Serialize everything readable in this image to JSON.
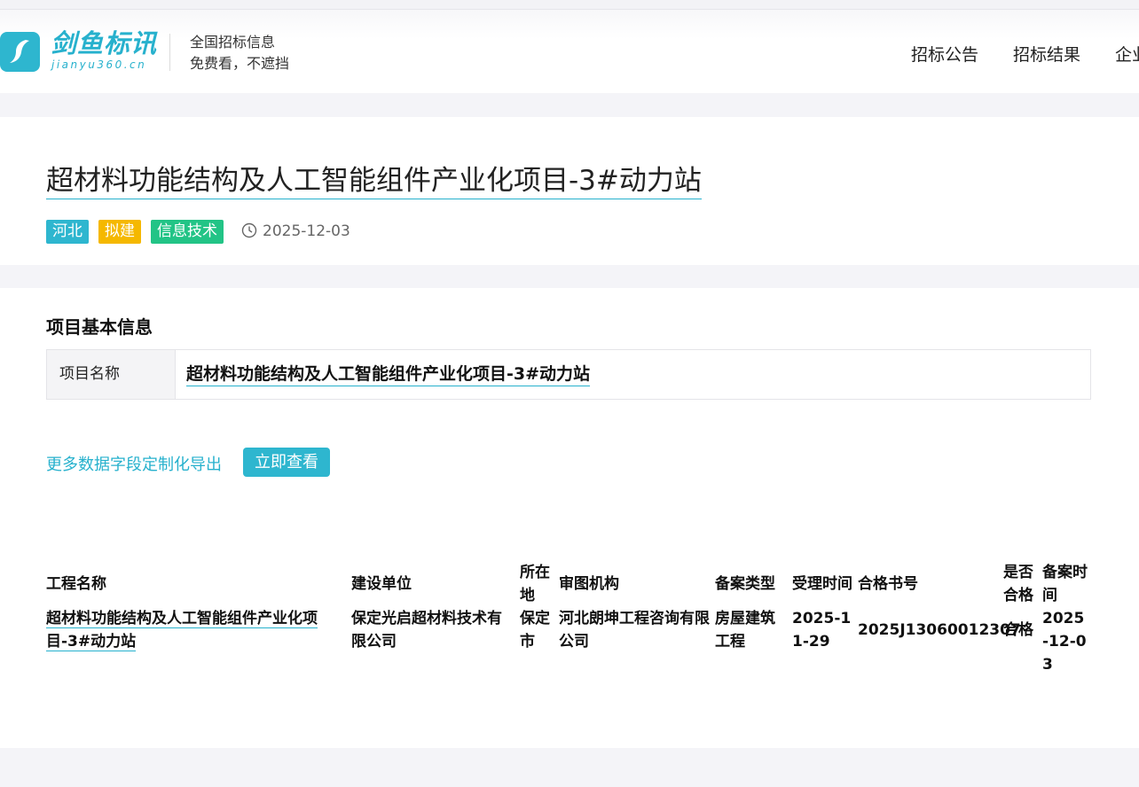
{
  "brand": {
    "name": "剑鱼标讯",
    "domain": "jianyu360.cn",
    "slogan_line1": "全国招标信息",
    "slogan_line2": "免费看，不遮挡",
    "color": "#2eb6cf"
  },
  "nav": [
    "招标公告",
    "招标结果",
    "企业"
  ],
  "notice": {
    "title": "超材料功能结构及人工智能组件产业化项目-3#动力站",
    "tags": [
      {
        "label": "河北",
        "color": "#2eb6cf"
      },
      {
        "label": "拟建",
        "color": "#f5b800"
      },
      {
        "label": "信息技术",
        "color": "#22c486"
      }
    ],
    "date_icon": "clock-icon",
    "date": "2025-12-03"
  },
  "basic_info": {
    "section_title": "项目基本信息",
    "label": "项目名称",
    "value": "超材料功能结构及人工智能组件产业化项目-3#动力站"
  },
  "export": {
    "link_text": "更多数据字段定制化导出",
    "button_label": "立即查看"
  },
  "records": {
    "headers": [
      "工程名称",
      "建设单位",
      "所在地",
      "审图机构",
      "备案类型",
      "受理时间",
      "合格书号",
      "是否合格",
      "备案时间"
    ],
    "row": [
      "超材料功能结构及人工智能组件产业化项目-3#动力站",
      "保定光启超材料技术有限公司",
      "保定市",
      "河北朗坤工程咨询有限公司",
      "房屋建筑工程",
      "2025-11-29",
      "2025J13060012307",
      "合格",
      "2025-12-03"
    ]
  }
}
